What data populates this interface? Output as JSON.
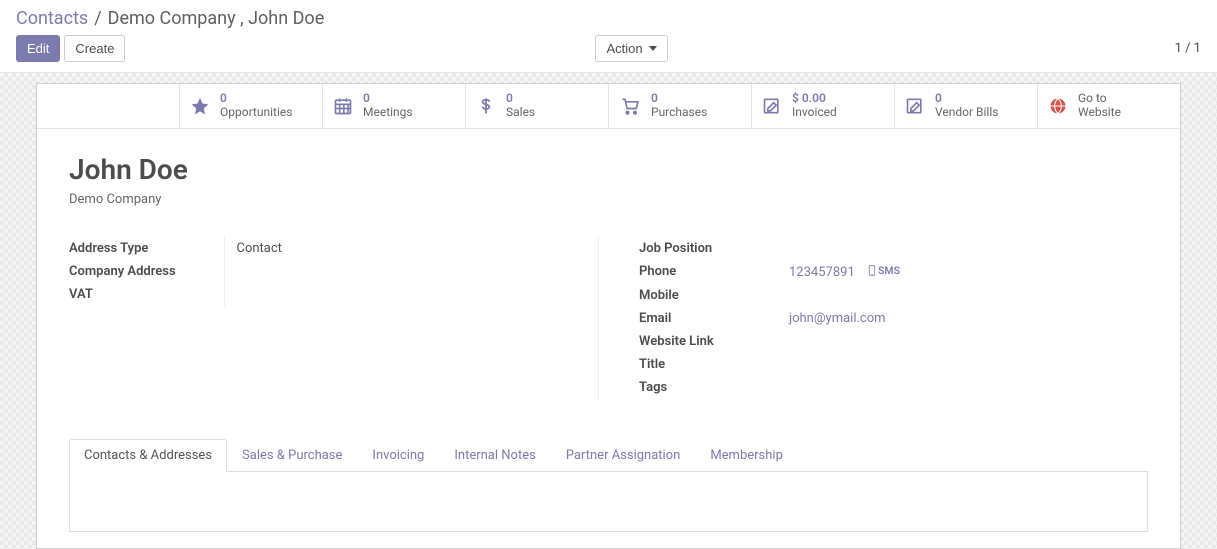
{
  "breadcrumb": {
    "root": "Contacts",
    "sep": "/",
    "current": "Demo Company , John Doe"
  },
  "buttons": {
    "edit": "Edit",
    "create": "Create",
    "action": "Action"
  },
  "pager": "1 / 1",
  "stats": {
    "opportunities": {
      "value": "0",
      "label": "Opportunities"
    },
    "meetings": {
      "value": "0",
      "label": "Meetings"
    },
    "sales": {
      "value": "0",
      "label": "Sales"
    },
    "purchases": {
      "value": "0",
      "label": "Purchases"
    },
    "invoiced": {
      "value": "$ 0.00",
      "label": "Invoiced"
    },
    "vendorbills": {
      "value": "0",
      "label": "Vendor Bills"
    },
    "website": {
      "label1": "Go to",
      "label2": "Website"
    }
  },
  "record": {
    "name": "John Doe",
    "company": "Demo Company"
  },
  "left_fields": {
    "address_type": {
      "label": "Address Type",
      "value": "Contact"
    },
    "company_address": {
      "label": "Company Address",
      "value": ""
    },
    "vat": {
      "label": "VAT",
      "value": ""
    }
  },
  "right_fields": {
    "job_position": {
      "label": "Job Position",
      "value": ""
    },
    "phone": {
      "label": "Phone",
      "value": "123457891",
      "sms": "SMS"
    },
    "mobile": {
      "label": "Mobile",
      "value": ""
    },
    "email": {
      "label": "Email",
      "value": "john@ymail.com"
    },
    "website_link": {
      "label": "Website Link",
      "value": ""
    },
    "title": {
      "label": "Title",
      "value": ""
    },
    "tags": {
      "label": "Tags",
      "value": ""
    }
  },
  "tabs": {
    "contacts": "Contacts & Addresses",
    "sales": "Sales & Purchase",
    "invoicing": "Invoicing",
    "internal": "Internal Notes",
    "partner": "Partner Assignation",
    "membership": "Membership"
  }
}
